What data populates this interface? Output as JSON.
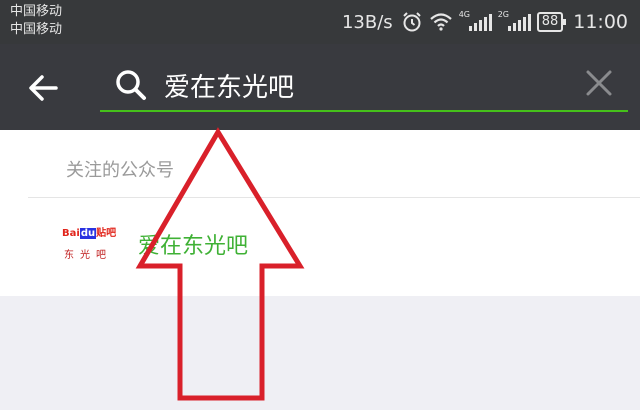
{
  "status_bar": {
    "carrier_1": "中国移动",
    "carrier_2": "中国移动",
    "net_speed": "13B/s",
    "sim1_network": "4G",
    "sim2_network": "2G",
    "battery": "88",
    "time": "11:00"
  },
  "search": {
    "query": "爱在东光吧",
    "icons": {
      "back": "back-arrow-icon",
      "search": "search-icon",
      "clear": "close-icon"
    }
  },
  "results": {
    "section_title": "关注的公众号",
    "items": [
      {
        "name": "爱在东光吧",
        "logo_brand_1": "Bai",
        "logo_brand_2": "du",
        "logo_brand_3": "贴吧",
        "logo_sub": "东光吧"
      }
    ]
  },
  "colors": {
    "status_bar_bg": "#37393b",
    "header_bg": "#393a3f",
    "accent_green": "#45c01a",
    "result_name_green": "#3fb135",
    "annotation_arrow": "#d9202a"
  }
}
